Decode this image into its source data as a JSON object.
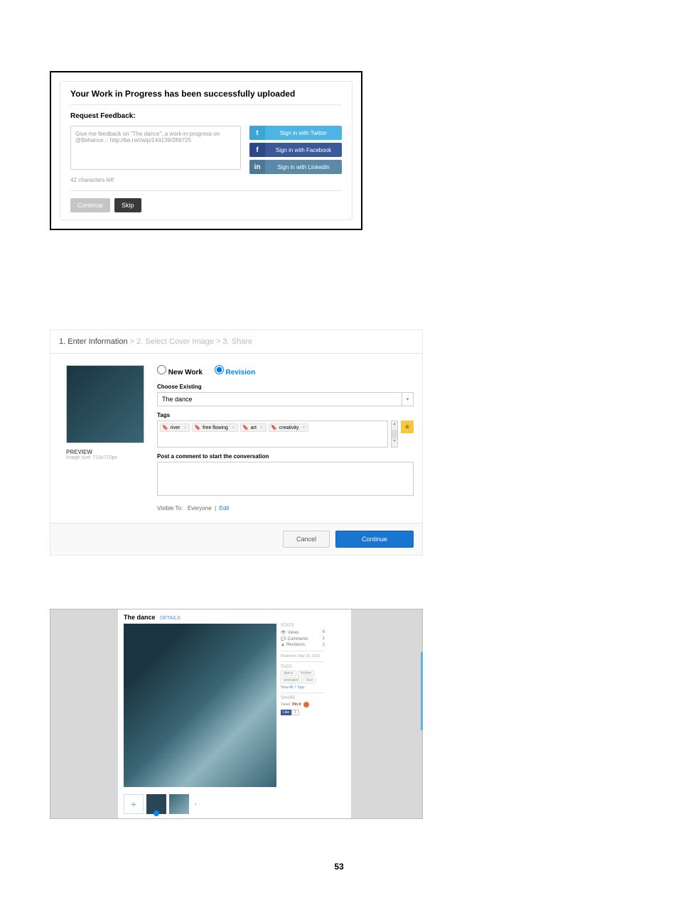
{
  "panel1": {
    "title": "Your Work in Progress has been successfully uploaded",
    "request_label": "Request Feedback:",
    "textarea_value": "Give me feedback on \"The dance\", a work-in-progress on @Behance :: http://be.net/wip/144139/289725",
    "chars_left": "42 characters left",
    "social": {
      "twitter": "Sign in with Twitter",
      "facebook": "Sign in with Facebook",
      "linkedin": "Sign in with LinkedIn"
    },
    "buttons": {
      "continue": "Continue",
      "skip": "Skip"
    }
  },
  "panel2": {
    "crumbs": {
      "s1": "1. Enter Information",
      "s2": "2. Select Cover Image",
      "s3": "3. Share",
      "sep": " > "
    },
    "preview": {
      "label": "PREVIEW",
      "size": "Image size: 710x710px"
    },
    "work_type": {
      "new": "New Work",
      "revision": "Revision"
    },
    "choose_label": "Choose Existing",
    "choose_value": "The dance",
    "tags_label": "Tags",
    "tags": [
      "river",
      "free flowing",
      "art",
      "creativity"
    ],
    "comment_label": "Post a comment to start the conversation",
    "visible_label": "Visible To:",
    "visible_value": "Everyone",
    "edit": "Edit",
    "buttons": {
      "cancel": "Cancel",
      "continue": "Continue"
    }
  },
  "panel3": {
    "title": "The dance",
    "status": "DETAILS",
    "stats_head": "STATS",
    "stats": {
      "views_label": "Views",
      "views": "6",
      "comments_label": "Comments",
      "comments": "1",
      "revisions_label": "Revisions",
      "revisions": "2"
    },
    "published": "Published: May 20, 2013",
    "tags_head": "TAGS",
    "tags": [
      "dance",
      "rhythm",
      "animation",
      "river"
    ],
    "view_all": "View All 7 Tags",
    "share_head": "SHARE",
    "tweet": "Tweet",
    "pin": "Pin it",
    "like": "Like",
    "like_count": "1",
    "add": "+"
  },
  "page_number": "53"
}
